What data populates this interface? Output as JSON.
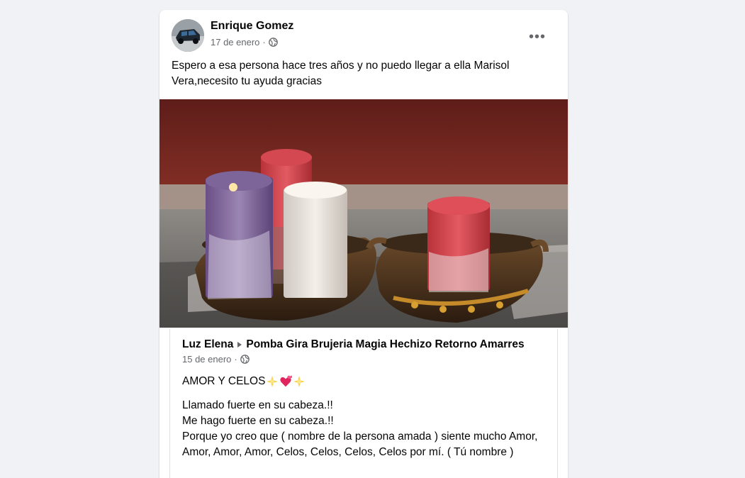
{
  "post": {
    "author": "Enrique Gomez",
    "date": "17 de enero",
    "separator": "·",
    "privacy_icon": "globe-icon",
    "more_icon": "more-options-icon",
    "more_label": "•••",
    "text": "Espero a esa persona hace tres años y no puedo llegar a ella Marisol Vera,necesito tu ayuda gracias",
    "photo_icon": "candles-photo"
  },
  "shared": {
    "author": "Luz Elena",
    "arrow_icon": "triangle-right-icon",
    "group": "Pomba Gira Brujeria Magia Hechizo Retorno Amarres",
    "date": "15 de enero",
    "separator": "·",
    "privacy_icon": "globe-icon",
    "title": "AMOR Y CELOS",
    "title_emojis": [
      "sparkle-emoji",
      "hearts-emoji",
      "sparkle-emoji"
    ],
    "lines": [
      "Llamado fuerte en su cabeza.!!",
      "Me hago fuerte en su cabeza.!!",
      "Porque yo creo que ( nombre de la persona amada ) siente mucho Amor, Amor, Amor, Amor, Celos, Celos, Celos, Celos por mí. ( Tú nombre )"
    ]
  },
  "colors": {
    "background": "#f0f2f5",
    "card": "#ffffff",
    "meta_text": "#65676b",
    "primary_text": "#050505"
  }
}
